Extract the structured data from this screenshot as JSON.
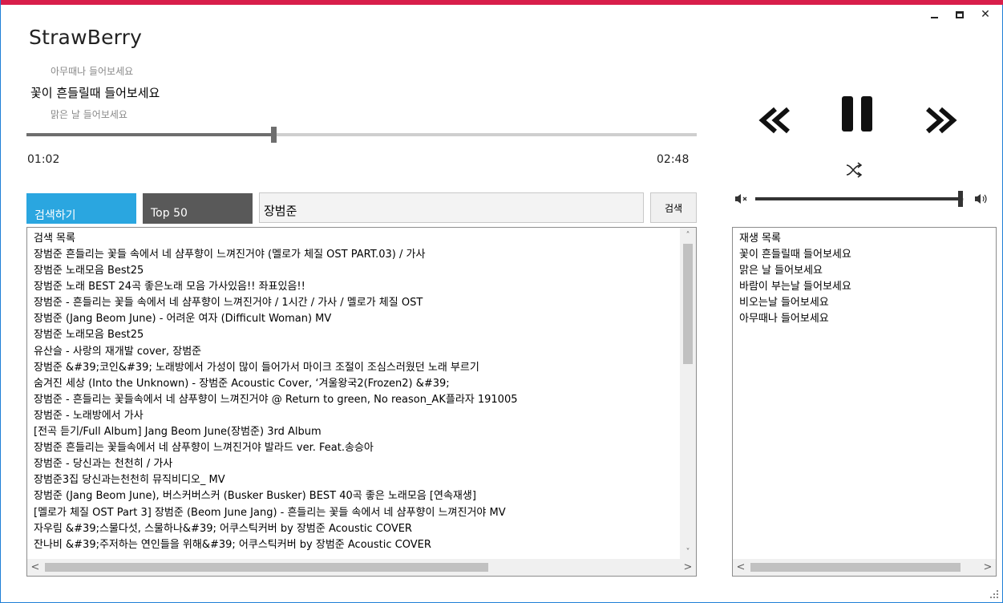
{
  "window": {
    "title": "StrawBerry",
    "minimize_icon": "minimize-icon",
    "maximize_icon": "maximize-icon",
    "close_glyph": "✕",
    "accent_color": "#d81e4a",
    "border_color": "#1f7fd6"
  },
  "now_playing": {
    "previous": "아무때나 들어보세요",
    "current": "꽃이 흔들릴때 들어보세요",
    "next": "맑은 날 들어보세요",
    "elapsed": "01:02",
    "total": "02:48",
    "progress": 0.369
  },
  "tabs": [
    {
      "label": "검색하기",
      "active": true,
      "color": "#2aa6e0"
    },
    {
      "label": "Top 50",
      "active": false,
      "color": "#595959"
    }
  ],
  "search": {
    "value": "장범준",
    "button_label": "검색"
  },
  "results": {
    "header": "검색 목록",
    "items": [
      "장범준 흔들리는 꽃들 속에서 네 샴푸향이 느껴진거야 (멜로가 체질 OST PART.03) / 가사",
      "장범준 노래모음 Best25",
      "장범준 노래  BEST 24곡 좋은노래 모음  가사있음!! 좌표있음!!",
      "장범준 - 흔들리는 꽃들 속에서 네 샴푸향이 느껴진거야 / 1시간 / 가사 / 멜로가 체질 OST",
      "장범준 (Jang Beom June) - 어려운 여자 (Difficult Woman) MV",
      "장범준 노래모음 Best25",
      "유산슬 - 사랑의 재개발 cover, 장범준",
      "장범준 &#39;코인&#39; 노래방에서 가성이 많이 들어가서 마이크 조절이 조심스러웠던 노래 부르기",
      "숨겨진 세상 (Into the Unknown) - 장범준 Acoustic Cover, ‘겨울왕국2(Frozen2) &#39;",
      "장범준 - 흔들리는 꽃들속에서 네 샴푸향이 느껴진거야 @ Return to green, No reason_AK플라자 191005",
      "장범준 - 노래방에서 가사",
      "[전곡 듣기/Full Album] Jang Beom June(장범준) 3rd Album",
      "장범준 흔들리는 꽃들속에서 네 샴푸향이 느껴진거야 발라드 ver. Feat.송승아",
      "장범준 - 당신과는 천천히 / 가사",
      "장범준3집 당신과는천천히 뮤직비디오_ MV",
      "장범준 (Jang Beom June), 버스커버스커 (Busker Busker) BEST 40곡 좋은 노래모음 [연속재생]",
      "[멜로가 체질 OST Part 3] 장범준 (Beom June Jang) - 흔들리는 꽃들 속에서 네 샴푸향이 느껴진거야 MV",
      "자우림 &#39;스물다섯, 스물하나&#39; 어쿠스틱커버 by 장범준 Acoustic COVER",
      "잔나비 &#39;주저하는 연인들을 위해&#39; 어쿠스틱커버 by 장범준 Acoustic COVER"
    ]
  },
  "playlist": {
    "header": "재생 목록",
    "items": [
      "꽃이 흔들릴때 들어보세요",
      "맑은 날 들어보세요",
      "바람이 부는날 들어보세요",
      "비오는날 들어보세요",
      "아무때나 들어보세요"
    ]
  },
  "controls": {
    "previous_icon": "rewind-icon",
    "pause_icon": "pause-icon",
    "next_icon": "fast-forward-icon",
    "shuffle_icon": "shuffle-icon"
  },
  "volume": {
    "level": 0.985,
    "mute_icon": "volume-mute-icon",
    "max_icon": "volume-up-icon"
  },
  "scroll_glyphs": {
    "up": "˄",
    "down": "˅",
    "left": "<",
    "right": ">"
  }
}
